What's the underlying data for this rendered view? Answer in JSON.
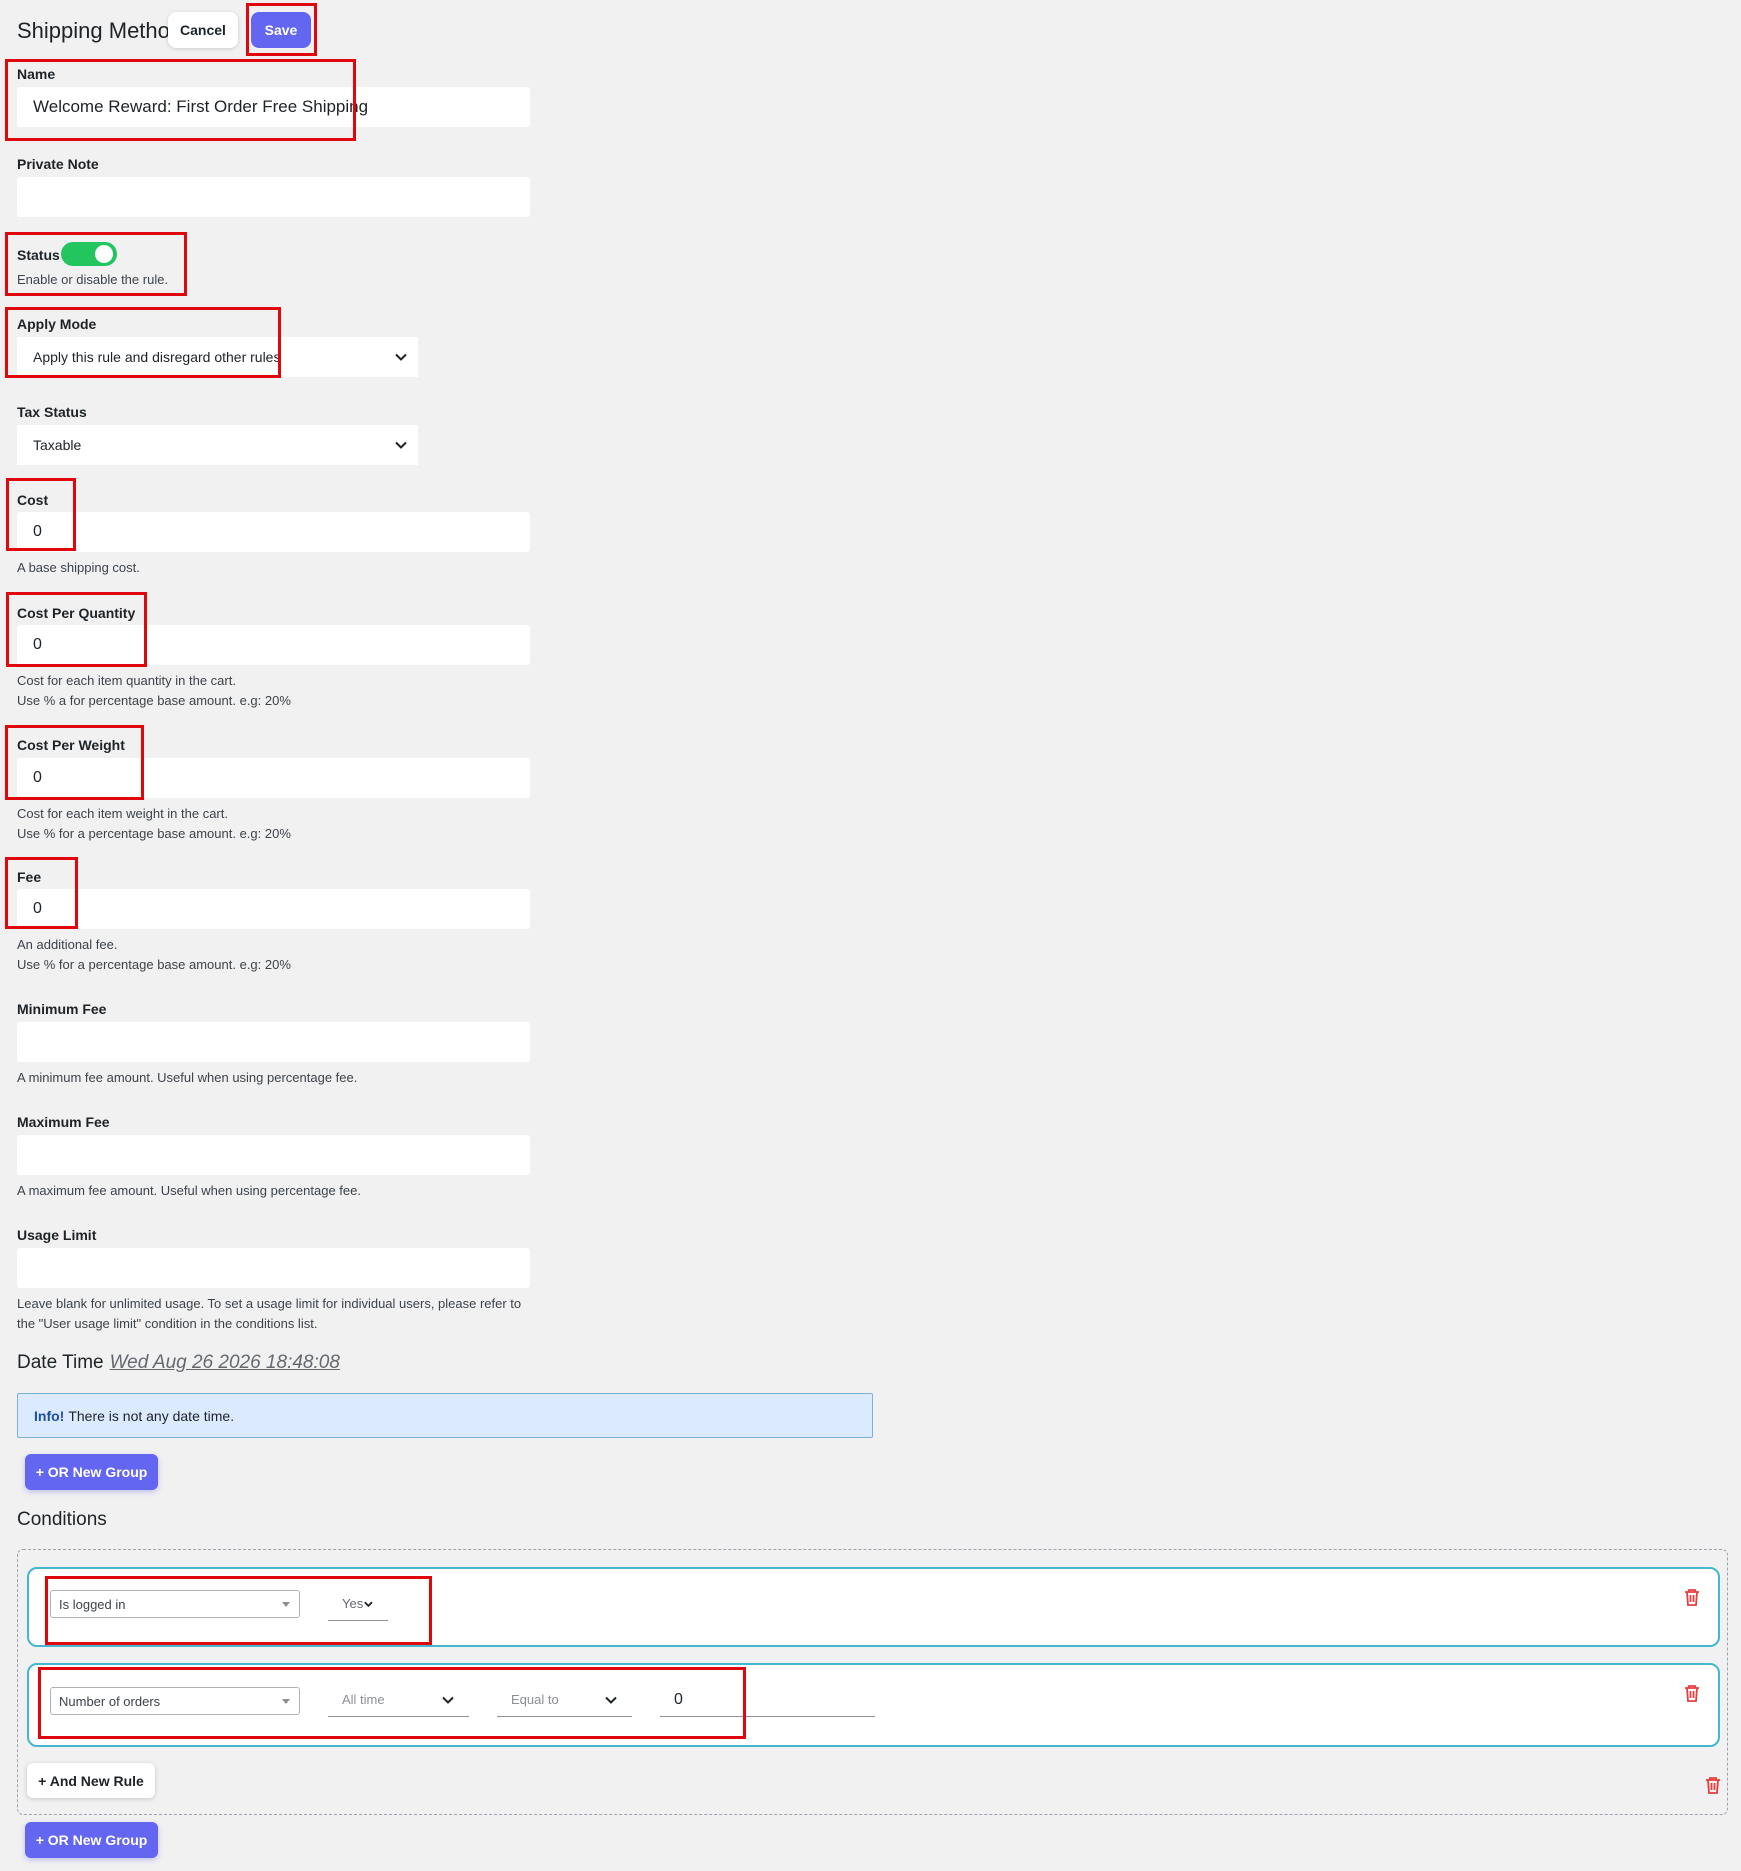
{
  "header": {
    "title": "Shipping Method",
    "cancel_label": "Cancel",
    "save_label": "Save"
  },
  "form": {
    "name": {
      "label": "Name",
      "value": "Welcome Reward: First Order Free Shipping"
    },
    "private_note": {
      "label": "Private Note",
      "value": ""
    },
    "status": {
      "label": "Status",
      "enabled": true,
      "help": "Enable or disable the rule."
    },
    "apply_mode": {
      "label": "Apply Mode",
      "value": "Apply this rule and disregard other rules"
    },
    "tax_status": {
      "label": "Tax Status",
      "value": "Taxable"
    },
    "cost": {
      "label": "Cost",
      "value": "0",
      "help": "A base shipping cost."
    },
    "cost_per_quantity": {
      "label": "Cost Per Quantity",
      "value": "0",
      "help1": "Cost for each item quantity in the cart.",
      "help2": "Use % a for percentage base amount. e.g: 20%"
    },
    "cost_per_weight": {
      "label": "Cost Per Weight",
      "value": "0",
      "help1": "Cost for each item weight in the cart.",
      "help2": "Use % for a percentage base amount. e.g: 20%"
    },
    "fee": {
      "label": "Fee",
      "value": "0",
      "help1": "An additional fee.",
      "help2": "Use % for a percentage base amount. e.g: 20%"
    },
    "minimum_fee": {
      "label": "Minimum Fee",
      "value": "",
      "help": "A minimum fee amount. Useful when using percentage fee."
    },
    "maximum_fee": {
      "label": "Maximum Fee",
      "value": "",
      "help": "A maximum fee amount. Useful when using percentage fee."
    },
    "usage_limit": {
      "label": "Usage Limit",
      "value": "",
      "help1": "Leave blank for unlimited usage. To set a usage limit for individual users, please refer to",
      "help2": "the \"User usage limit\" condition in the conditions list."
    }
  },
  "date_time": {
    "title": "Date Time",
    "value": "Wed Aug 26 2026 18:48:08",
    "info_strong": "Info!",
    "info_text": "There is not any date time.",
    "or_group_label": "+ OR New Group"
  },
  "conditions": {
    "title": "Conditions",
    "rules": [
      {
        "condition": "Is logged in",
        "value": "Yes"
      },
      {
        "condition": "Number of orders",
        "period": "All time",
        "operator": "Equal to",
        "value": "0"
      }
    ],
    "and_rule_label": "+ And New Rule",
    "or_group_label": "+ OR New Group"
  },
  "colors": {
    "accent": "#6366f1",
    "toggle_on": "#22c55e",
    "highlight": "#e0080c",
    "rule_border": "#45b6cf",
    "danger": "#e53e3e"
  },
  "icons": {
    "dropdown": "chevron-down-icon",
    "delete": "trash-icon"
  }
}
